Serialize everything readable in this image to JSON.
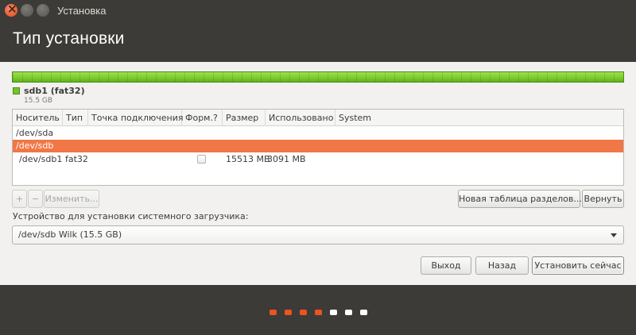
{
  "window": {
    "title": "Установка"
  },
  "page": {
    "title": "Тип установки"
  },
  "partition_legend": {
    "name": "sdb1 (fat32)",
    "size": "15.5 GB",
    "color": "#76c22a"
  },
  "table": {
    "headers": [
      "Носитель",
      "Тип",
      "Точка подключения",
      "Форм.?",
      "Размер",
      "Использовано",
      "System"
    ],
    "rows": [
      {
        "device": "/dev/sda",
        "selected": false
      },
      {
        "device": "/dev/sdb",
        "selected": true
      },
      {
        "device": "/dev/sdb1",
        "type": "fat32",
        "mount": "",
        "format": false,
        "size": "15513 MB",
        "used": "3091 MB",
        "system": ""
      }
    ]
  },
  "buttons": {
    "add": "+",
    "remove": "−",
    "change": "Изменить...",
    "new_table": "Новая таблица разделов...",
    "revert": "Вернуть",
    "quit": "Выход",
    "back": "Назад",
    "install": "Установить сейчас"
  },
  "bootloader": {
    "label": "Устройство для установки системного загрузчика:",
    "selected": "/dev/sdb   Wilk  (15.5 GB)"
  },
  "progress": {
    "total_steps": 7,
    "completed_steps": 4,
    "active_color": "#e95420",
    "inactive_color": "#ffffff"
  },
  "colors": {
    "accent": "#f07746",
    "header_bg": "#3c3b37"
  }
}
